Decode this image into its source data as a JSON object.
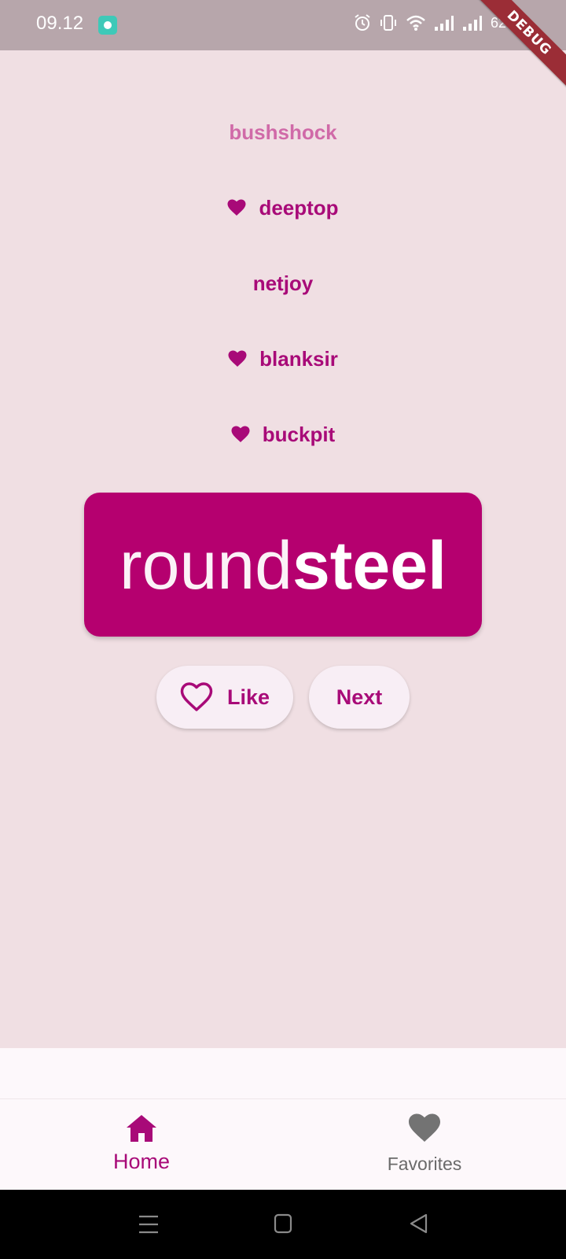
{
  "status_bar": {
    "time": "09.12",
    "battery": "62%"
  },
  "debug_banner": "DEBUG",
  "history": [
    {
      "word": "bushshock",
      "favorite": false,
      "faded": true
    },
    {
      "word": "deeptop",
      "favorite": true,
      "faded": false
    },
    {
      "word": "netjoy",
      "favorite": false,
      "faded": false
    },
    {
      "word": "blanksir",
      "favorite": true,
      "faded": false
    },
    {
      "word": "buckpit",
      "favorite": true,
      "faded": false
    }
  ],
  "current_pair": {
    "first": "round",
    "second": "steel"
  },
  "buttons": {
    "like_label": "Like",
    "next_label": "Next"
  },
  "nav": {
    "home_label": "Home",
    "favorites_label": "Favorites",
    "selected": "home"
  },
  "colors": {
    "primary": "#a80a78",
    "card": "#b5006f",
    "background": "#f0dfe3"
  },
  "icons": {
    "favorite": "heart-icon",
    "like": "heart-outline-icon",
    "home": "home-icon",
    "favorites": "heart-icon"
  }
}
